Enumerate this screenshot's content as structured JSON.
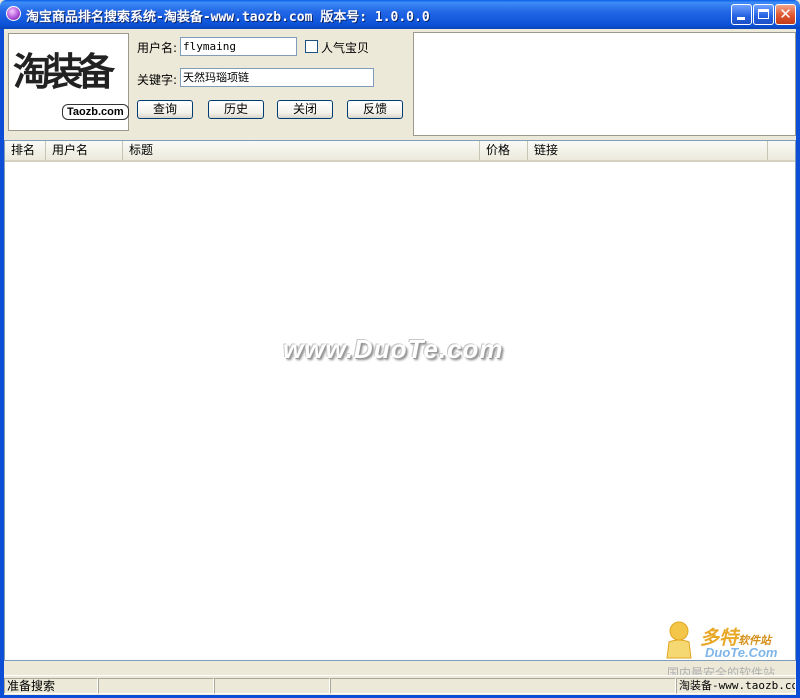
{
  "window": {
    "title": "淘宝商品排名搜索系统-淘装备-www.taozb.com 版本号: 1.0.0.0",
    "close_glyph": "✕"
  },
  "logo": {
    "chinese": "淘装备",
    "english": "Taozb.com"
  },
  "form": {
    "username_label": "用户名:",
    "username_value": "flymaing",
    "popular_label": "人气宝贝",
    "popular_checked": false,
    "keyword_label": "关键字:",
    "keyword_value": "天然玛瑙项链"
  },
  "buttons": {
    "search": "查询",
    "history": "历史",
    "close": "关闭",
    "feedback": "反馈"
  },
  "list": {
    "columns": [
      "排名",
      "用户名",
      "标题",
      "价格",
      "链接"
    ],
    "rows": []
  },
  "watermark": {
    "center": "www.DuoTe.com",
    "corner_brand": "多特",
    "corner_brand_small": "软件站",
    "corner_url": "DuoTe.Com",
    "corner_slogan": "国内最安全的软件站"
  },
  "status": {
    "left": "准备搜索",
    "right": "淘装备-www.taozb.com"
  }
}
